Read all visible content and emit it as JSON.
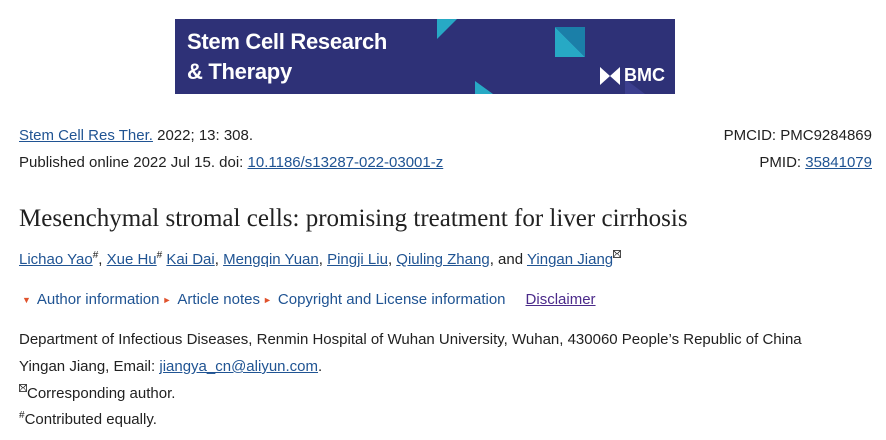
{
  "banner": {
    "line1": "Stem Cell Research",
    "line2": "& Therapy",
    "publisher": "BMC",
    "bg_color": "#2e3177",
    "accent_color": "#27a9c5"
  },
  "citation": {
    "journal_link": "Stem Cell Res Ther.",
    "volume_info": " 2022; 13: 308.",
    "pmcid": "PMCID: PMC9284869",
    "published_prefix": "Published online 2022 Jul 15. doi: ",
    "doi_link": "10.1186/s13287-022-03001-z",
    "pmid_label": "PMID: ",
    "pmid_link": "35841079"
  },
  "article": {
    "title": "Mesenchymal stromal cells: promising treatment for liver cirrhosis"
  },
  "authors": [
    {
      "name": "Lichao Yao",
      "mark": "#"
    },
    {
      "name": "Xue Hu",
      "mark": "#"
    },
    {
      "name": "Kai Dai"
    },
    {
      "name": "Mengqin Yuan"
    },
    {
      "name": "Pingji Liu"
    },
    {
      "name": "Qiuling Zhang"
    },
    {
      "name": "Yingan Jiang",
      "mark": "envelope"
    }
  ],
  "authors_and": "and",
  "infobar": {
    "author_information": "Author information",
    "article_notes": "Article notes",
    "copyright": "Copyright and License information",
    "disclaimer": "Disclaimer"
  },
  "affiliation": {
    "department": "Department of Infectious Diseases, Renmin Hospital of Wuhan University, Wuhan, 430060 People’s Republic of China",
    "email_prefix": "Yingan Jiang, Email: ",
    "email": "jiangya_cn@aliyun.com",
    "email_suffix": ".",
    "corresponding": "Corresponding author.",
    "contributed": "Contributed equally.",
    "hash_mark": "#"
  }
}
